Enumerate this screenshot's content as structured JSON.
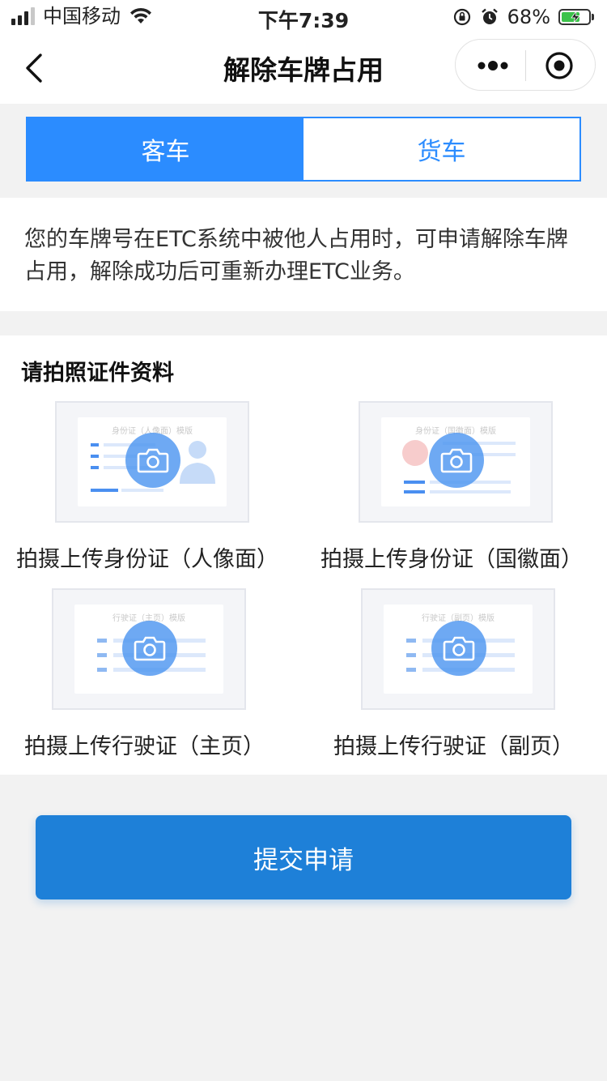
{
  "status_bar": {
    "carrier": "中国移动",
    "time": "下午7:39",
    "battery": "68%",
    "battery_level": 0.68
  },
  "nav": {
    "title": "解除车牌占用"
  },
  "tabs": [
    {
      "label": "客车",
      "active": true
    },
    {
      "label": "货车",
      "active": false
    }
  ],
  "notice": {
    "text": "您的车牌号在ETC系统中被他人占用时，可申请解除车牌占用，解除成功后可重新办理ETC业务。"
  },
  "upload": {
    "title": "请拍照证件资料",
    "items": [
      {
        "template_label": "身份证（人像面）模版",
        "caption": "拍摄上传身份证（人像面）"
      },
      {
        "template_label": "身份证（国徽面）模版",
        "caption": "拍摄上传身份证（国徽面）"
      },
      {
        "template_label": "行驶证（主页）模版",
        "caption": "拍摄上传行驶证（主页）"
      },
      {
        "template_label": "行驶证（副页）模版",
        "caption": "拍摄上传行驶证（副页）"
      }
    ]
  },
  "submit": {
    "label": "提交申请"
  },
  "colors": {
    "accent": "#2b8cff",
    "submit": "#1e80d8",
    "background": "#f2f2f2"
  }
}
